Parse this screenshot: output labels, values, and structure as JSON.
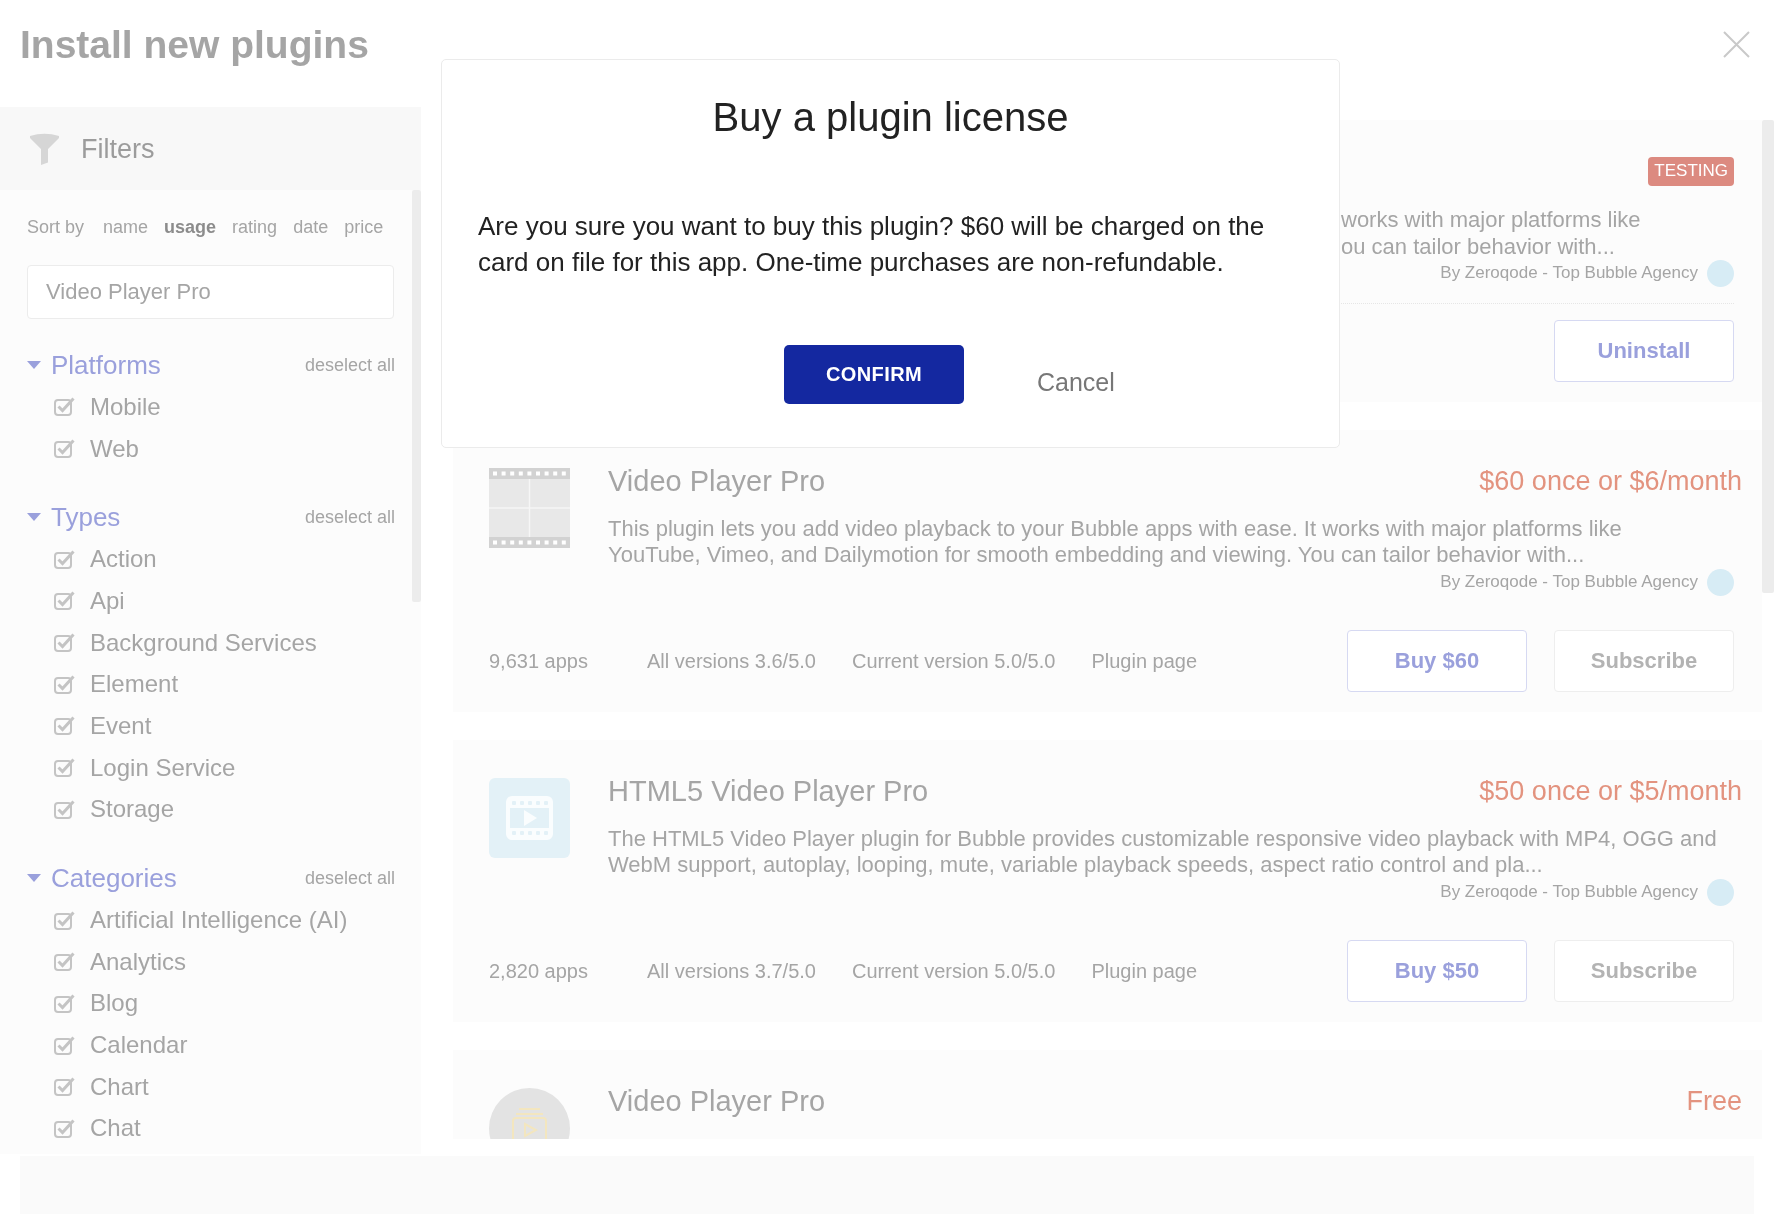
{
  "page": {
    "title": "Install new plugins"
  },
  "sidebar": {
    "title": "Filters",
    "sort": {
      "label": "Sort by",
      "options": [
        {
          "label": "name",
          "selected": false
        },
        {
          "label": "usage",
          "selected": true
        },
        {
          "label": "rating",
          "selected": false
        },
        {
          "label": "date",
          "selected": false
        },
        {
          "label": "price",
          "selected": false
        }
      ]
    },
    "search": {
      "value": "Video Player Pro"
    },
    "sections": [
      {
        "title": "Platforms",
        "expanded": true,
        "action": "deselect all",
        "items": [
          {
            "label": "Mobile",
            "checked": true
          },
          {
            "label": "Web",
            "checked": true
          }
        ]
      },
      {
        "title": "Types",
        "expanded": true,
        "action": "deselect all",
        "items": [
          {
            "label": "Action",
            "checked": true
          },
          {
            "label": "Api",
            "checked": true
          },
          {
            "label": "Background Services",
            "checked": true
          },
          {
            "label": "Element",
            "checked": true
          },
          {
            "label": "Event",
            "checked": true
          },
          {
            "label": "Login Service",
            "checked": true
          },
          {
            "label": "Storage",
            "checked": true
          }
        ]
      },
      {
        "title": "Categories",
        "expanded": true,
        "action": "deselect all",
        "items": [
          {
            "label": "Artificial Intelligence (AI)",
            "checked": true
          },
          {
            "label": "Analytics",
            "checked": true
          },
          {
            "label": "Blog",
            "checked": true
          },
          {
            "label": "Calendar",
            "checked": true
          },
          {
            "label": "Chart",
            "checked": true
          },
          {
            "label": "Chat",
            "checked": true
          }
        ]
      }
    ]
  },
  "plugins": [
    {
      "kind": "covered",
      "badge": "TESTING",
      "description": [
        "works with major platforms like",
        "ou can tailor behavior with..."
      ],
      "author": "By Zeroqode - Top Bubble Agency",
      "buttons": [
        {
          "label": "Uninstall",
          "disabled": false
        }
      ]
    },
    {
      "kind": "film",
      "title": "Video Player Pro",
      "price": "$60 once or $6/month",
      "description": [
        "This plugin lets you add video playback to your Bubble apps with ease. It works with major platforms like",
        "YouTube, Vimeo, and Dailymotion for smooth embedding and viewing. You can tailor behavior with..."
      ],
      "author": "By Zeroqode - Top Bubble Agency",
      "stats": [
        "9,631 apps",
        "All versions 3.6/5.0",
        "Current version 5.0/5.0"
      ],
      "link": "Plugin page",
      "buttons": [
        {
          "label": "Buy $60",
          "disabled": false
        },
        {
          "label": "Subscribe",
          "disabled": true
        }
      ]
    },
    {
      "kind": "play",
      "title": "HTML5 Video Player Pro",
      "price": "$50 once or $5/month",
      "description": [
        "The HTML5 Video Player plugin for Bubble provides customizable responsive video playback with MP4, OGG and",
        "WebM support, autoplay, looping, mute, variable playback speeds, aspect ratio control and pla..."
      ],
      "author": "By Zeroqode - Top Bubble Agency",
      "stats": [
        "2,820 apps",
        "All versions 3.7/5.0",
        "Current version 5.0/5.0"
      ],
      "link": "Plugin page",
      "buttons": [
        {
          "label": "Buy $50",
          "disabled": false
        },
        {
          "label": "Subscribe",
          "disabled": true
        }
      ]
    },
    {
      "kind": "disc",
      "title": "Video Player Pro",
      "price": "Free"
    }
  ],
  "dialog": {
    "title": "Buy a plugin license",
    "message": "Are you sure you want to buy this plugin? $60 will be charged on the card on file for this app. One-time purchases are non-refundable.",
    "buttons": [
      {
        "label": "CONFIRM",
        "kind": "primary"
      },
      {
        "label": "Cancel",
        "kind": "text"
      }
    ]
  }
}
